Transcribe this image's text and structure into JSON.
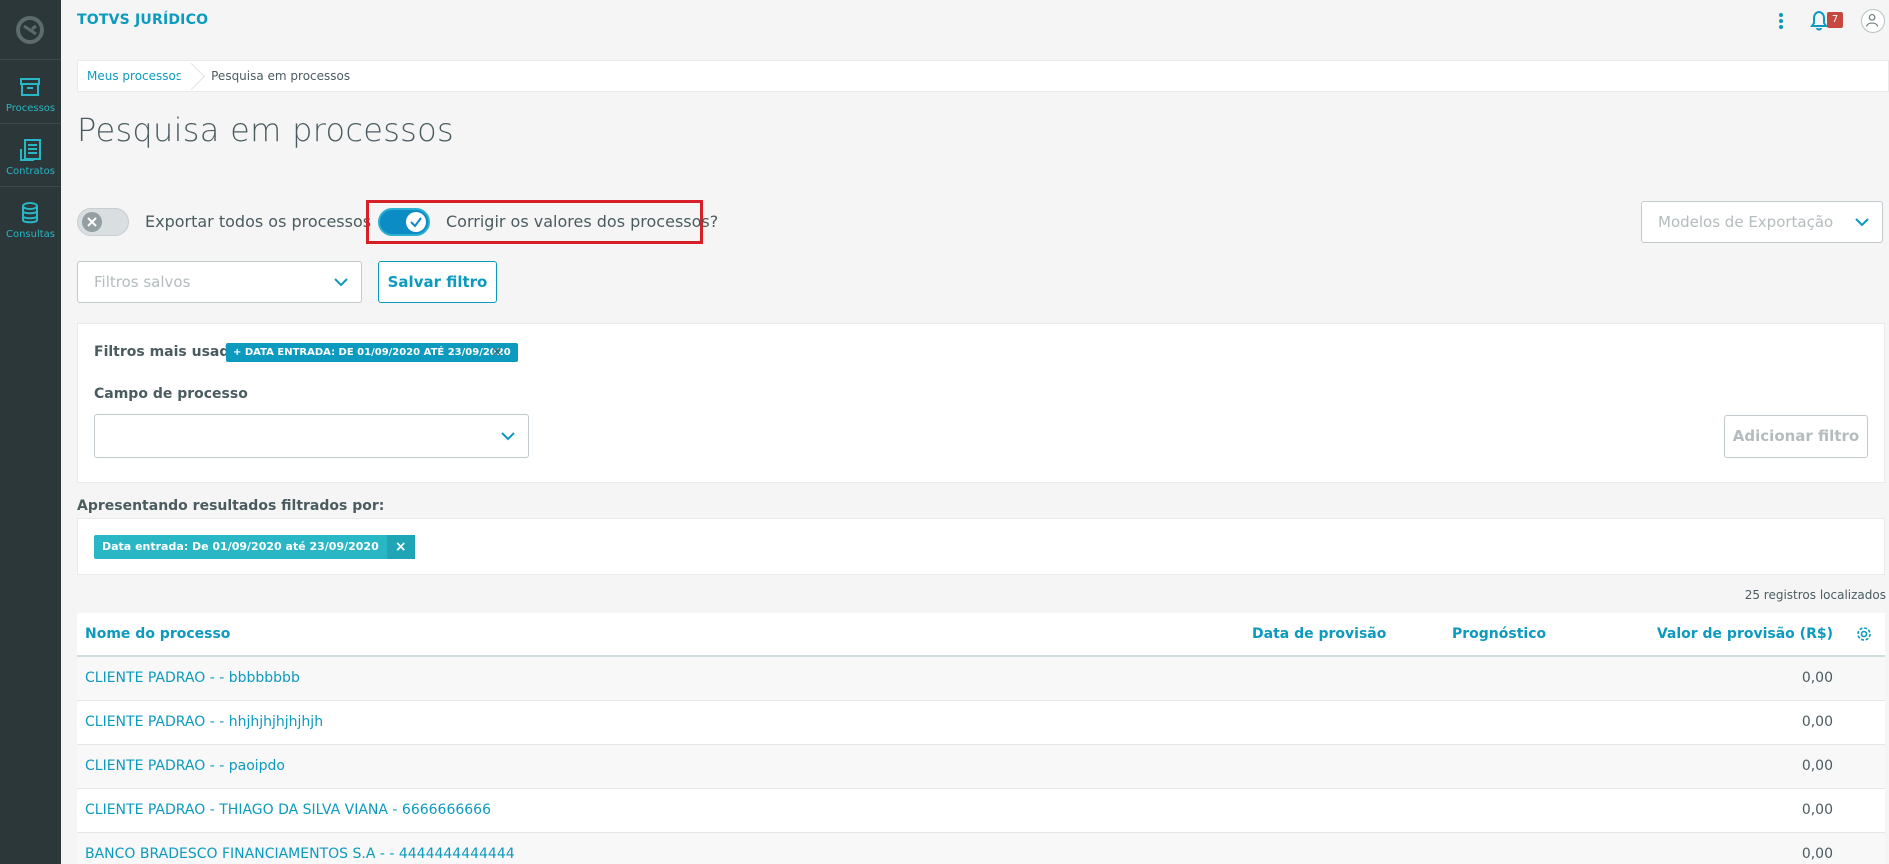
{
  "app": {
    "title": "TOTVS JURÍDICO",
    "notification_count": "7"
  },
  "sidebar": {
    "items": [
      {
        "label": "Processos",
        "icon": "archive-icon"
      },
      {
        "label": "Contratos",
        "icon": "contracts-icon"
      },
      {
        "label": "Consultas",
        "icon": "database-icon"
      }
    ]
  },
  "breadcrumb": {
    "link": "Meus processos",
    "current": "Pesquisa em processos"
  },
  "page": {
    "title": "Pesquisa em processos"
  },
  "toggles": {
    "export_all": {
      "label": "Exportar todos os processos",
      "checked": false
    },
    "correct_values": {
      "label": "Corrigir os valores dos processos?",
      "checked": true
    }
  },
  "export_models": {
    "placeholder": "Modelos de Exportação"
  },
  "saved_filters": {
    "placeholder": "Filtros salvos",
    "save_button": "Salvar filtro"
  },
  "filter_panel": {
    "most_used_label": "Filtros mais usados",
    "most_used_chip": "+  DATA ENTRADA: DE 01/09/2020 ATÉ 23/09/2020",
    "remove_mark": "×",
    "field_label": "Campo de processo",
    "add_button": "Adicionar filtro"
  },
  "results": {
    "label": "Apresentando resultados filtrados por:",
    "active_chip": "Data entrada: De 01/09/2020 até 23/09/2020",
    "remove_mark": "×",
    "count": "25 registros localizados"
  },
  "table": {
    "columns": [
      "Nome do processo",
      "Data de provisão",
      "Prognóstico",
      "Valor de provisão (R$)"
    ],
    "rows": [
      {
        "name": "CLIENTE PADRAO - - bbbbbbbb",
        "value": "0,00"
      },
      {
        "name": "CLIENTE PADRAO - - hhjhjhjhjhjhjh",
        "value": "0,00"
      },
      {
        "name": "CLIENTE PADRAO - - paoipdo",
        "value": "0,00"
      },
      {
        "name": "CLIENTE PADRAO - THIAGO DA SILVA VIANA - 6666666666",
        "value": "0,00"
      },
      {
        "name": "BANCO BRADESCO FINANCIAMENTOS S.A - - 4444444444444",
        "value": "0,00"
      }
    ]
  },
  "colors": {
    "accent": "#0c9abe",
    "sidebar": "#2c3739",
    "highlight": "#d61f26",
    "chip": "#29b6c5"
  }
}
